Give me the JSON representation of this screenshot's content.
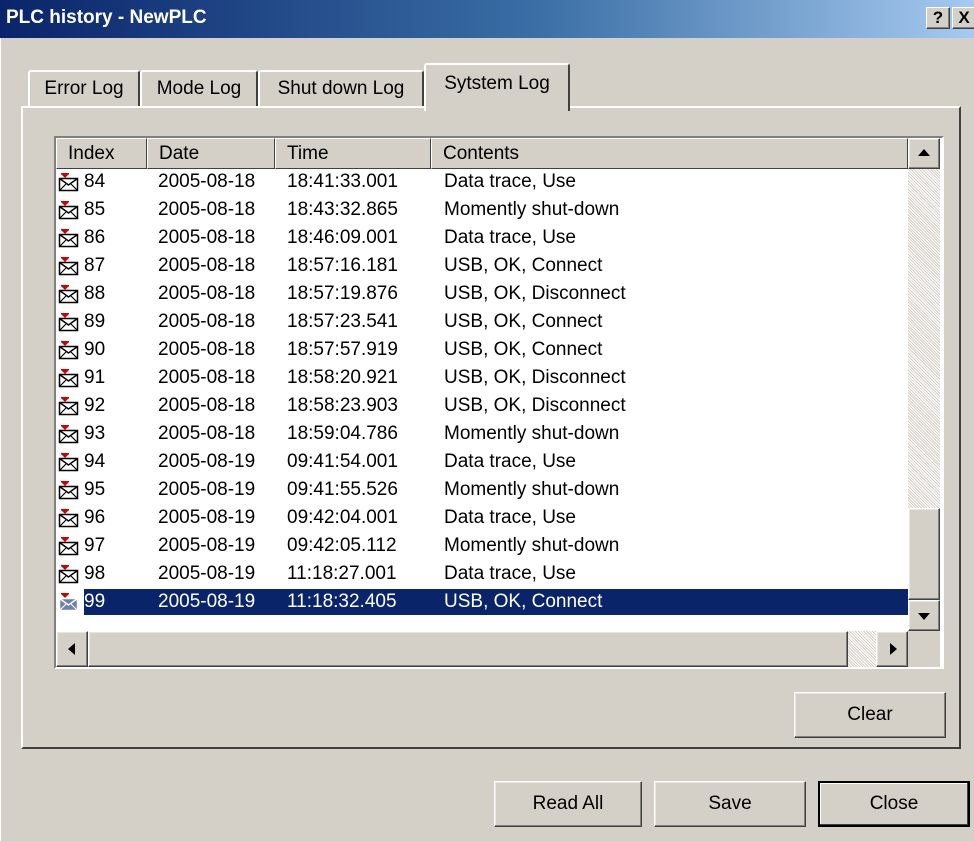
{
  "window": {
    "title": "PLC history - NewPLC",
    "help_button": "?",
    "close_button": "X"
  },
  "tabs": [
    {
      "label": "Error Log",
      "active": false
    },
    {
      "label": "Mode Log",
      "active": false
    },
    {
      "label": "Shut down Log",
      "active": false
    },
    {
      "label": "Sytstem Log",
      "active": true
    }
  ],
  "list": {
    "columns": {
      "index": "Index",
      "date": "Date",
      "time": "Time",
      "contents": "Contents"
    },
    "rows": [
      {
        "index": "84",
        "date": "2005-08-18",
        "time": "18:41:33.001",
        "contents": "Data trace, Use",
        "selected": false
      },
      {
        "index": "85",
        "date": "2005-08-18",
        "time": "18:43:32.865",
        "contents": "Momently shut-down",
        "selected": false
      },
      {
        "index": "86",
        "date": "2005-08-18",
        "time": "18:46:09.001",
        "contents": "Data trace, Use",
        "selected": false
      },
      {
        "index": "87",
        "date": "2005-08-18",
        "time": "18:57:16.181",
        "contents": "USB, OK, Connect",
        "selected": false
      },
      {
        "index": "88",
        "date": "2005-08-18",
        "time": "18:57:19.876",
        "contents": "USB, OK, Disconnect",
        "selected": false
      },
      {
        "index": "89",
        "date": "2005-08-18",
        "time": "18:57:23.541",
        "contents": "USB, OK, Connect",
        "selected": false
      },
      {
        "index": "90",
        "date": "2005-08-18",
        "time": "18:57:57.919",
        "contents": "USB, OK, Connect",
        "selected": false
      },
      {
        "index": "91",
        "date": "2005-08-18",
        "time": "18:58:20.921",
        "contents": "USB, OK, Disconnect",
        "selected": false
      },
      {
        "index": "92",
        "date": "2005-08-18",
        "time": "18:58:23.903",
        "contents": "USB, OK, Disconnect",
        "selected": false
      },
      {
        "index": "93",
        "date": "2005-08-18",
        "time": "18:59:04.786",
        "contents": "Momently shut-down",
        "selected": false
      },
      {
        "index": "94",
        "date": "2005-08-19",
        "time": "09:41:54.001",
        "contents": "Data trace, Use",
        "selected": false
      },
      {
        "index": "95",
        "date": "2005-08-19",
        "time": "09:41:55.526",
        "contents": "Momently shut-down",
        "selected": false
      },
      {
        "index": "96",
        "date": "2005-08-19",
        "time": "09:42:04.001",
        "contents": "Data trace, Use",
        "selected": false
      },
      {
        "index": "97",
        "date": "2005-08-19",
        "time": "09:42:05.112",
        "contents": "Momently shut-down",
        "selected": false
      },
      {
        "index": "98",
        "date": "2005-08-19",
        "time": "11:18:27.001",
        "contents": "Data trace, Use",
        "selected": false
      },
      {
        "index": "99",
        "date": "2005-08-19",
        "time": "11:18:32.405",
        "contents": "USB, OK, Connect",
        "selected": true
      }
    ],
    "row_icon": "envelope-icon"
  },
  "buttons": {
    "clear": "Clear",
    "read_all": "Read All",
    "save": "Save",
    "close": "Close"
  },
  "colors": {
    "face": "#d4d0c8",
    "selection": "#0a246a",
    "title_start": "#0a246a",
    "title_end": "#a6caf0"
  }
}
